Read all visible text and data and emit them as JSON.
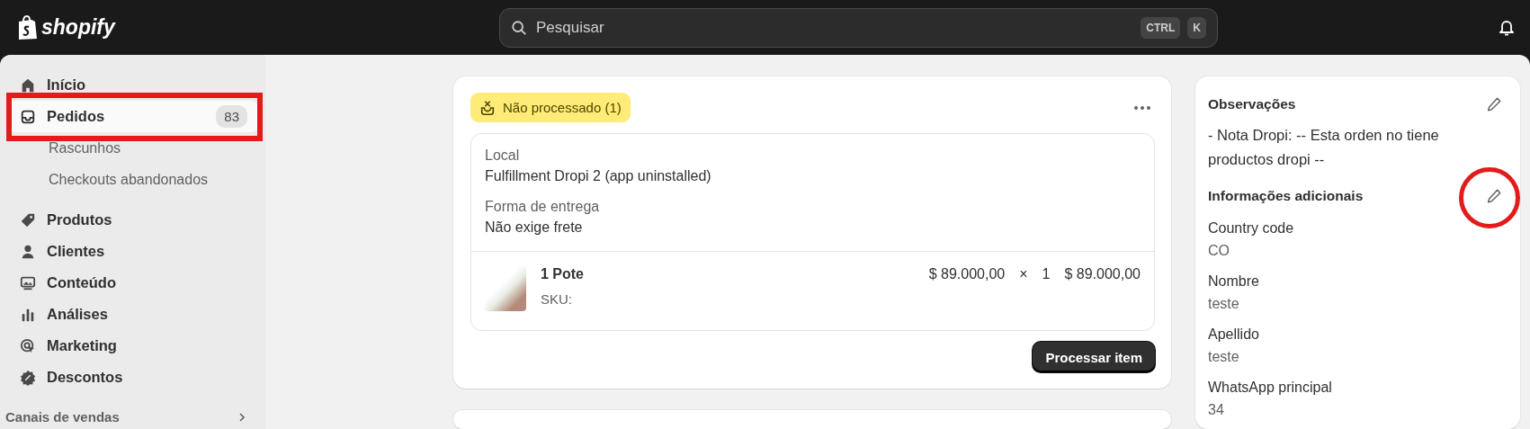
{
  "top_bar": {
    "logo": "shopify",
    "search": {
      "placeholder": "Pesquisar",
      "shortcut": [
        "CTRL",
        "K"
      ]
    }
  },
  "sidebar": {
    "items": [
      {
        "label": "Início",
        "kind": "home",
        "selected": false
      },
      {
        "label": "Pedidos",
        "kind": "orders",
        "selected": true,
        "count": "83",
        "children": [
          {
            "label": "Rascunhos"
          },
          {
            "label": "Checkouts abandonados"
          }
        ]
      },
      {
        "label": "Produtos",
        "kind": "products",
        "selected": false
      },
      {
        "label": "Clientes",
        "kind": "customers",
        "selected": false
      },
      {
        "label": "Conteúdo",
        "kind": "content",
        "selected": false
      },
      {
        "label": "Análises",
        "kind": "analytics",
        "selected": false
      },
      {
        "label": "Marketing",
        "kind": "marketing",
        "selected": false
      },
      {
        "label": "Descontos",
        "kind": "discounts",
        "selected": false
      }
    ],
    "section": "Canais de vendas"
  },
  "fulfillment_card": {
    "status": "Não processado (1)",
    "details": [
      {
        "label": "Local",
        "value": "Fulfillment Dropi 2 (app uninstalled)"
      },
      {
        "label": "Forma de entrega",
        "value": "Não exige frete"
      }
    ],
    "line_item": {
      "name": "1 Pote",
      "sku": "SKU:",
      "price": "$ 89.000,00",
      "times": "×",
      "quantity": "1",
      "total": "$ 89.000,00"
    },
    "button": "Processar item"
  },
  "notes_card": {
    "title": "Observações",
    "note": "- Nota Dropi: -- Esta orden no tiene productos dropi --",
    "additional_title": "Informações adicionais",
    "attributes": [
      {
        "label": "Country code",
        "value": "CO"
      },
      {
        "label": "Nombre",
        "value": "teste"
      },
      {
        "label": "Apellido",
        "value": "teste"
      },
      {
        "label": "WhatsApp principal",
        "value": "34"
      }
    ]
  }
}
